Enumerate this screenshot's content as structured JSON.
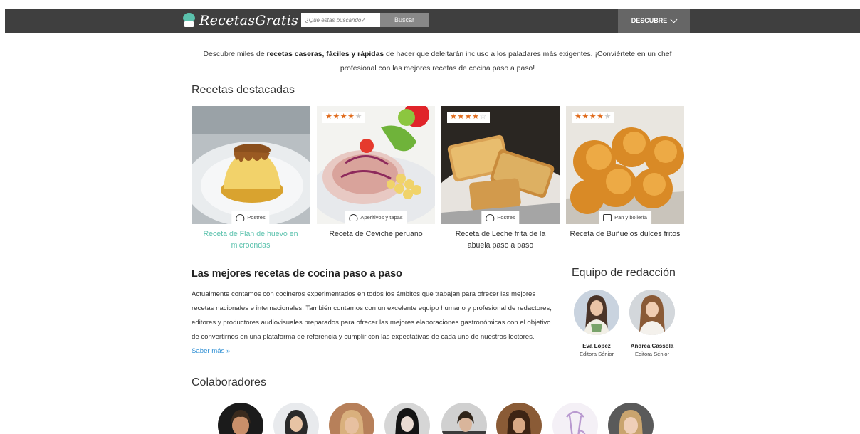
{
  "header": {
    "brand": "RecetasGratis",
    "search_placeholder": "¿Qué estás buscando?",
    "search_button": "Buscar",
    "menu_label": "DESCUBRE",
    "background_color": "#3f3f3f",
    "brand_color": "#5bc2ad"
  },
  "intro": {
    "part1": "Descubre miles de ",
    "bold": "recetas caseras, fáciles y rápidas",
    "part2": " de hacer que deleitarán incluso a los paladares más exigentes. ¡Conviértete en un chef profesional con las mejores recetas de cocina paso a paso!"
  },
  "featured": {
    "heading": "Recetas destacadas",
    "cards": [
      {
        "title": "Receta de Flan de huevo en microondas",
        "category": "Postres",
        "category_icon": "dessert-icon",
        "rating": null
      },
      {
        "title": "Receta de Ceviche peruano",
        "category": "Aperitivos y tapas",
        "category_icon": "appetizer-icon",
        "rating": 4
      },
      {
        "title": "Receta de Leche frita de la abuela paso a paso",
        "category": "Postres",
        "category_icon": "dessert-icon",
        "rating": 4.5
      },
      {
        "title": "Receta de Buñuelos dulces fritos",
        "category": "Pan y bollería",
        "category_icon": "bread-icon",
        "rating": 4
      }
    ]
  },
  "best": {
    "heading": "Las mejores recetas de cocina paso a paso",
    "text": "Actualmente contamos con cocineros experimentados en todos los ámbitos que trabajan para ofrecer las mejores recetas nacionales e internacionales. También contamos con un excelente equipo humano y profesional de redactores, editores y productores audiovisuales preparados para ofrecer las mejores elaboraciones gastronómicas con el objetivo de convertirnos en una plataforma de referencia y cumplir con las expectativas de cada uno de nuestros lectores. ",
    "more_link": "Saber más »"
  },
  "team": {
    "heading": "Equipo de redacción",
    "editors": [
      {
        "name": "Eva López",
        "role": "Editora Sénior"
      },
      {
        "name": "Andrea Cassola",
        "role": "Editora Sénior"
      }
    ]
  },
  "collaborators": {
    "heading": "Colaboradores",
    "count_visible": 8
  }
}
